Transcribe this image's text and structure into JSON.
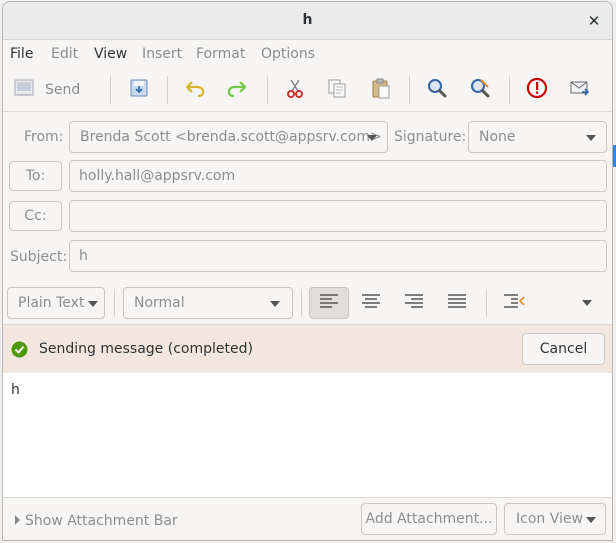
{
  "window": {
    "title": "h"
  },
  "menu": {
    "file": "File",
    "edit": "Edit",
    "view": "View",
    "insert": "Insert",
    "format": "Format",
    "options": "Options"
  },
  "toolbar": {
    "send_label": "Send"
  },
  "header": {
    "from_label": "From:",
    "from_value": "Brenda Scott <brenda.scott@appsrv.com>",
    "signature_label": "Signature:",
    "signature_value": "None",
    "to_label": "To:",
    "to_value": "holly.hall@appsrv.com",
    "cc_label": "Cc:",
    "cc_value": "",
    "subject_label": "Subject:",
    "subject_value": "h"
  },
  "format": {
    "mode": "Plain Text",
    "paragraph_style": "Normal"
  },
  "status": {
    "message": "Sending message (completed)",
    "cancel_label": "Cancel"
  },
  "body": {
    "text": "h"
  },
  "bottom": {
    "show_attachment_bar": "Show Attachment Bar",
    "add_attachment": "Add Attachment...",
    "view_mode": "Icon View"
  },
  "colors": {
    "status_bg": "#f2e6df",
    "success_green": "#4e9a06",
    "undo_yellow": "#d8b32e",
    "redo_green": "#73c648",
    "cut_red": "#cc3333",
    "priority_red": "#cc0000",
    "find_blue": "#3465a4"
  }
}
